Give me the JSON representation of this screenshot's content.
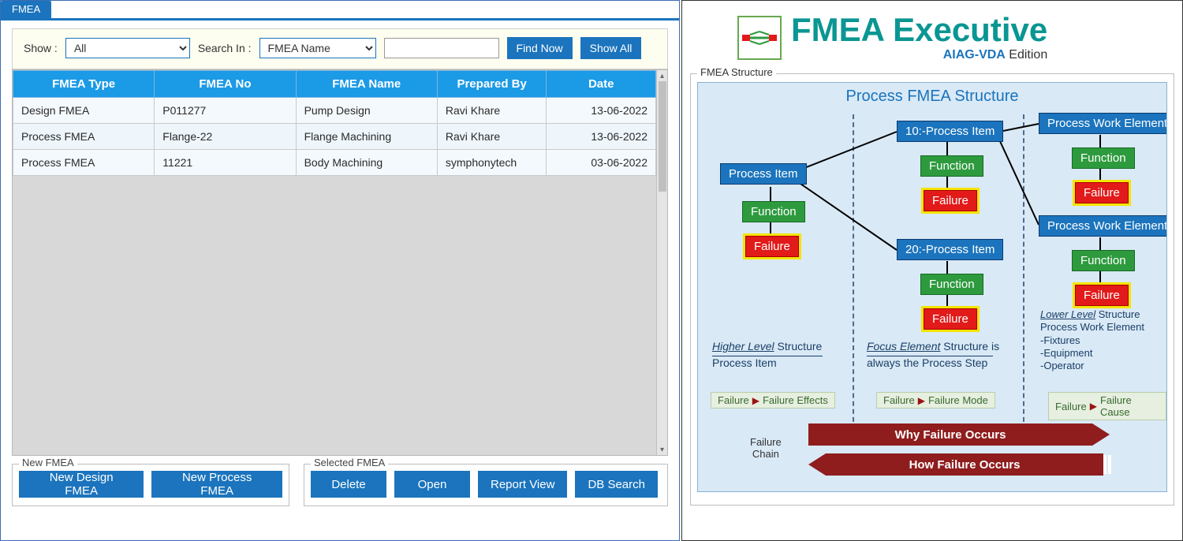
{
  "tab": {
    "label": "FMEA"
  },
  "filter": {
    "show_label": "Show :",
    "show_value": "All",
    "search_in_label": "Search In :",
    "search_in_value": "FMEA Name",
    "search_value": "",
    "find_now": "Find Now",
    "show_all": "Show All"
  },
  "grid": {
    "headers": [
      "FMEA Type",
      "FMEA No",
      "FMEA Name",
      "Prepared By",
      "Date"
    ],
    "rows": [
      {
        "type": "Design FMEA",
        "no": "P011277",
        "name": "Pump Design",
        "by": "Ravi Khare",
        "date": "13-06-2022"
      },
      {
        "type": "Process FMEA",
        "no": "Flange-22",
        "name": "Flange Machining",
        "by": "Ravi Khare",
        "date": "13-06-2022"
      },
      {
        "type": "Process FMEA",
        "no": "11221",
        "name": "Body Machining",
        "by": "symphonytech",
        "date": "03-06-2022"
      }
    ]
  },
  "fieldsets": {
    "new": {
      "legend": "New FMEA",
      "design": "New Design FMEA",
      "process": "New Process FMEA"
    },
    "sel": {
      "legend": "Selected FMEA",
      "delete": "Delete",
      "open": "Open",
      "report": "Report View",
      "db": "DB Search"
    }
  },
  "brand": {
    "title": "FMEA Executive",
    "subtitle_strong": "AIAG-VDA",
    "subtitle_rest": " Edition",
    "structure_legend": "FMEA Structure"
  },
  "diagram": {
    "title": "Process FMEA  Structure",
    "nodes": {
      "pi": "Process Item",
      "fn": "Function",
      "fail": "Failure",
      "p10": "10:-Process Item",
      "p20": "20:-Process Item",
      "pwe": "Process Work Element"
    },
    "higher": {
      "u": "Higher Level",
      "rest": " Structure",
      "sub": "Process Item"
    },
    "focus": {
      "u": "Focus Element",
      "rest": " Structure is",
      "sub": "always the Process Step"
    },
    "lower": {
      "u": "Lower Level",
      "rest": " Structure",
      "l1": "Process Work Element",
      "l2": "-Fixtures",
      "l3": "-Equipment",
      "l4": "-Operator"
    },
    "chips": {
      "c1a": "Failure",
      "c1b": "Failure Effects",
      "c2a": "Failure",
      "c2b": "Failure Mode",
      "c3a": "Failure",
      "c3b": "Failure Cause"
    },
    "why": "Why Failure Occurs",
    "how": "How Failure Occurs",
    "failchain1": "Failure",
    "failchain2": "Chain"
  }
}
